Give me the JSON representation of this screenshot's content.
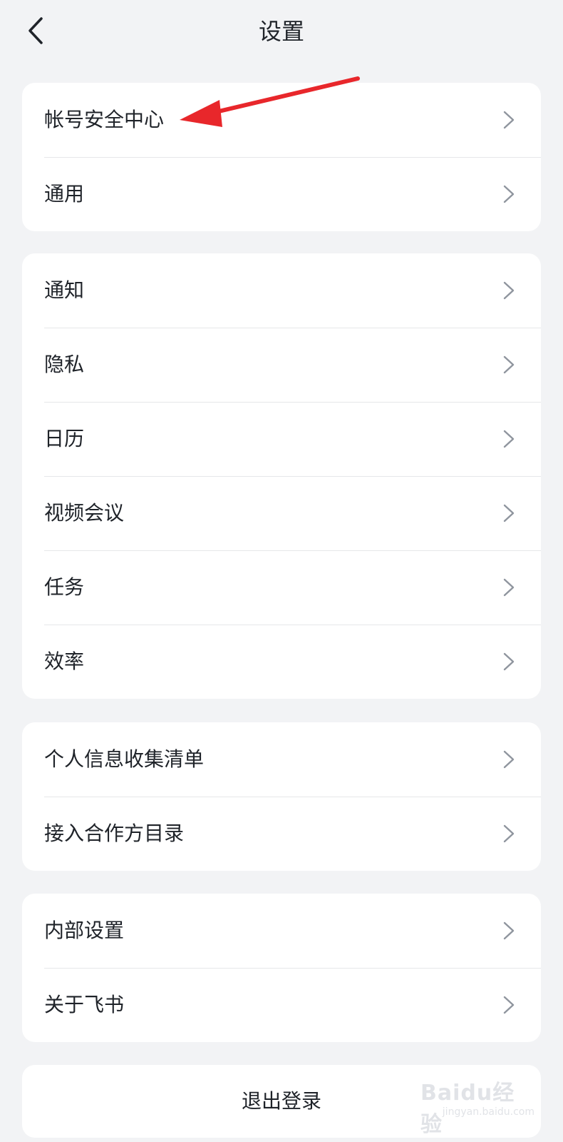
{
  "header": {
    "title": "设置",
    "back_icon": "chevron-left-icon"
  },
  "groups": [
    {
      "items": [
        {
          "label": "帐号安全中心"
        },
        {
          "label": "通用"
        }
      ]
    },
    {
      "items": [
        {
          "label": "通知"
        },
        {
          "label": "隐私"
        },
        {
          "label": "日历"
        },
        {
          "label": "视频会议"
        },
        {
          "label": "任务"
        },
        {
          "label": "效率"
        }
      ]
    },
    {
      "items": [
        {
          "label": "个人信息收集清单"
        },
        {
          "label": "接入合作方目录"
        }
      ]
    },
    {
      "items": [
        {
          "label": "内部设置"
        },
        {
          "label": "关于飞书"
        }
      ]
    }
  ],
  "logout": {
    "label": "退出登录"
  },
  "annotation": {
    "type": "arrow",
    "color": "#e8272b",
    "points_to": "帐号安全中心"
  },
  "watermark": {
    "brand": "Baidu经验",
    "url": "jingyan.baidu.com"
  },
  "colors": {
    "background": "#f2f3f5",
    "card": "#ffffff",
    "divider": "#e6e7e9",
    "text": "#1f2329",
    "chevron": "#8f959e"
  }
}
